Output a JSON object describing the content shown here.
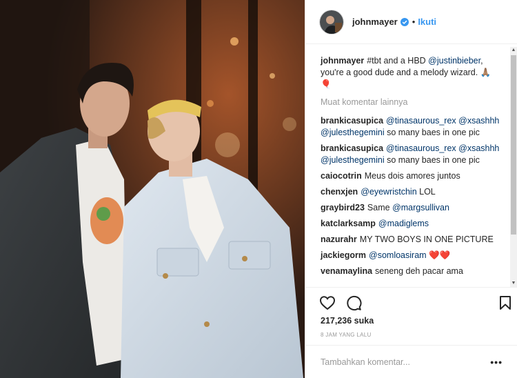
{
  "photo": {
    "alt_icon": "post-photo"
  },
  "header": {
    "username": "johnmayer",
    "separator": "•",
    "follow_label": "Ikuti",
    "verified_icon": "verified-badge-icon"
  },
  "caption": {
    "username": "johnmayer",
    "text_before": "#tbt and a HBD ",
    "mention": "@justinbieber",
    "text_after": ", you're a good dude and a melody wizard. 🙏🏽🎈"
  },
  "load_more_label": "Muat komentar lainnya",
  "comments": [
    {
      "username": "brankicasupica",
      "m1": "@tinasaurous_rex",
      "m2": "@xsashhh",
      "m3": "@julesthegemini",
      "rest": " so many baes in one pic"
    },
    {
      "username": "brankicasupica",
      "m1": "@tinasaurous_rex",
      "m2": "@xsashhh",
      "m3": "@julesthegemini",
      "rest": " so many baes in one pic"
    },
    {
      "username": "caiocotrin",
      "text": "Meus dois amores juntos"
    },
    {
      "username": "chenxjen",
      "mention": "@eyewristchin",
      "text": " LOL"
    },
    {
      "username": "graybird23",
      "text": "Same ",
      "mention": "@margsullivan"
    },
    {
      "username": "katclarksamp",
      "mention": "@madiglems"
    },
    {
      "username": "nazurahr",
      "text": "MY TWO BOYS IN ONE PICTURE"
    },
    {
      "username": "jackiegorm",
      "mention": "@somloasiram",
      "text": " ❤️❤️"
    },
    {
      "username": "venamaylina",
      "text": "seneng deh pacar ama"
    }
  ],
  "likes": "217,236 suka",
  "time": "8 JAM YANG LALU",
  "add_comment": {
    "placeholder": "Tambahkan komentar...",
    "more_label": "•••"
  },
  "colors": {
    "link": "#003569",
    "follow": "#3897f0",
    "muted": "#999999",
    "border": "#efefef"
  },
  "icons": [
    "heart-icon",
    "comment-icon",
    "bookmark-icon"
  ]
}
